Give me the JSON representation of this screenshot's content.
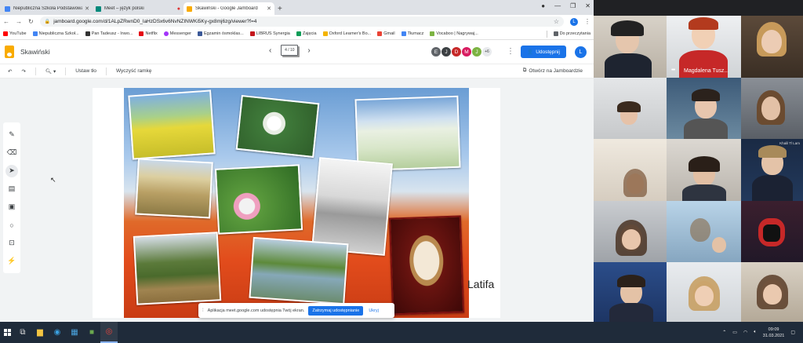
{
  "browser": {
    "tabs": [
      {
        "title": "Niepubliczna Szkoła Podstawowa",
        "color": "#4285f4"
      },
      {
        "title": "Meet – język polski",
        "color": "#00897b"
      },
      {
        "title": "Skawiński - Google Jamboard",
        "color": "#f9ab00"
      }
    ],
    "url": "jamboard.google.com/d/1ALpZRwnD0_laHzDSx6v6NvNZINWKi5Ky-gx8mj6zg/viewer?f=4",
    "account_initial": "L",
    "bookmarks": [
      {
        "label": "YouTube",
        "color": "#ff0000"
      },
      {
        "label": "Niepubliczna Szkoł...",
        "color": "#4285f4"
      },
      {
        "label": "Pan Tadeusz - Inwo...",
        "color": "#333333"
      },
      {
        "label": "Netflix",
        "color": "#e50914"
      },
      {
        "label": "Messenger",
        "color": "#a334fa"
      },
      {
        "label": "Egzamin ósmoklas...",
        "color": "#3b5998"
      },
      {
        "label": "LIBRUS Synergia",
        "color": "#c4161c"
      },
      {
        "label": "Zajęcia",
        "color": "#0f9d58"
      },
      {
        "label": "Oxford Learner's Bo...",
        "color": "#f4b400"
      },
      {
        "label": "Gmail",
        "color": "#ea4335"
      },
      {
        "label": "Tłumacz",
        "color": "#4285f4"
      },
      {
        "label": "Vocaboo | Nagrywaj...",
        "color": "#7cb342"
      },
      {
        "label": "Do przeczytania",
        "color": "#5f6368"
      }
    ]
  },
  "jamboard": {
    "title": "Skawiński",
    "frame_indicator": "4 / 10",
    "collaborators": [
      {
        "initial": "E",
        "color": "#5f6368"
      },
      {
        "initial": "J",
        "color": "#3c4043"
      },
      {
        "initial": "D",
        "color": "#c62828"
      },
      {
        "initial": "M",
        "color": "#d81b60"
      },
      {
        "initial": "J",
        "color": "#7cb342"
      }
    ],
    "collaborators_more": "+6",
    "share_label": "Udostępnij",
    "account_initial": "L",
    "toolbar": {
      "set_background": "Ustaw tło",
      "clear_frame": "Wyczyść ramkę",
      "open_in_jamboard": "Otwórz na Jamboardzie"
    },
    "canvas_text": "Latifa"
  },
  "screen_share_bar": {
    "message": "Aplikacja meet.google.com udostępnia Twój ekran.",
    "stop_label": "Zatrzymaj udostępnianie",
    "hide_label": "Ukryj"
  },
  "meet": {
    "participant_name": "Magdalena Tusz...",
    "tile_tag": "Khalil Tl Lam"
  },
  "taskbar": {
    "time": "09:09",
    "date": "31.03.2021"
  }
}
